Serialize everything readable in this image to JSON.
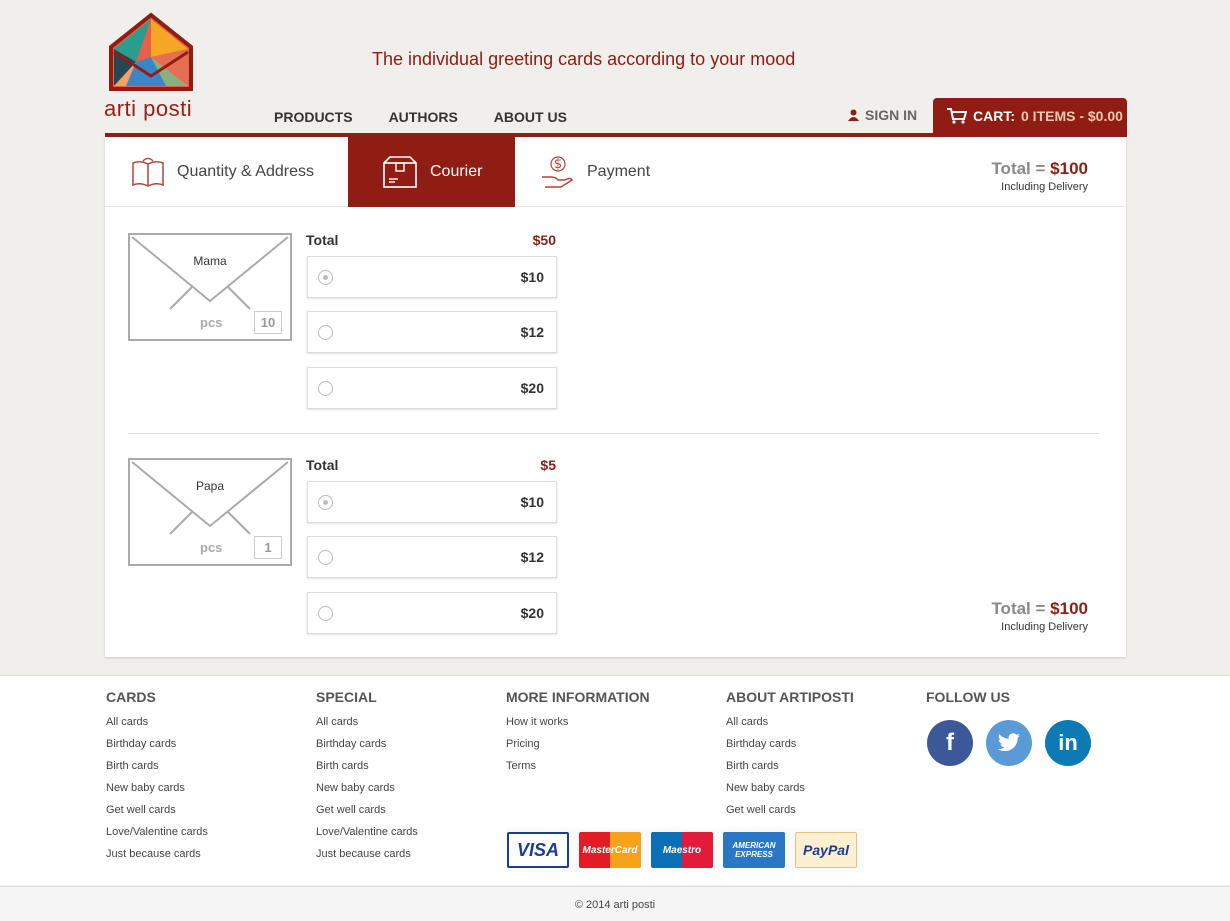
{
  "brand": {
    "name": "arti posti",
    "tagline": "The individual greeting cards according to your mood"
  },
  "nav": [
    {
      "label": "PRODUCTS"
    },
    {
      "label": "AUTHORS"
    },
    {
      "label": "ABOUT US"
    }
  ],
  "account": {
    "signin": "SIGN IN"
  },
  "cart": {
    "label": "CART:",
    "summary": "0 ITEMS - $0.00"
  },
  "steps": [
    {
      "label": "Quantity & Address",
      "icon": "book-icon"
    },
    {
      "label": "Courier",
      "icon": "box-icon",
      "active": true
    },
    {
      "label": "Payment",
      "icon": "money-hand-icon"
    }
  ],
  "summary": {
    "total_label": "Total = ",
    "total_value": "$100",
    "note": "Including Delivery"
  },
  "orders": [
    {
      "name": "Mama",
      "pcs_label": "pcs",
      "qty": "10",
      "total_label": "Total",
      "total_value": "$50",
      "options": [
        {
          "price": "$10",
          "selected": true
        },
        {
          "price": "$12",
          "selected": false
        },
        {
          "price": "$20",
          "selected": false
        }
      ]
    },
    {
      "name": "Papa",
      "pcs_label": "pcs",
      "qty": "1",
      "total_label": "Total",
      "total_value": "$5",
      "options": [
        {
          "price": "$10",
          "selected": true
        },
        {
          "price": "$12",
          "selected": false
        },
        {
          "price": "$20",
          "selected": false
        }
      ]
    }
  ],
  "footer": {
    "cards": {
      "title": "CARDS",
      "links": [
        "All cards",
        "Birthday cards",
        "Birth cards",
        "New baby cards",
        "Get well cards",
        "Love/Valentine cards",
        "Just because cards"
      ]
    },
    "special": {
      "title": "SPECIAL",
      "links": [
        "All cards",
        "Birthday cards",
        "Birth cards",
        "New baby cards",
        "Get well cards",
        "Love/Valentine cards",
        "Just because cards"
      ]
    },
    "more": {
      "title": "MORE INFORMATION",
      "links": [
        "How it works",
        "Pricing",
        "Terms"
      ]
    },
    "about": {
      "title": "ABOUT ARTIPOSTI",
      "links": [
        "All cards",
        "Birthday cards",
        "Birth cards",
        "New baby cards",
        "Get well cards"
      ]
    },
    "follow": {
      "title": "FOLLOW US"
    },
    "payments": [
      "VISA",
      "MasterCard",
      "Maestro",
      "AMERICAN EXPRESS",
      "PayPal"
    ],
    "copyright": "© 2014 arti posti"
  },
  "colors": {
    "accent": "#8f1d13",
    "facebook": "#3b5998",
    "twitter": "#5a9ad5",
    "linkedin": "#0b7ab5"
  }
}
